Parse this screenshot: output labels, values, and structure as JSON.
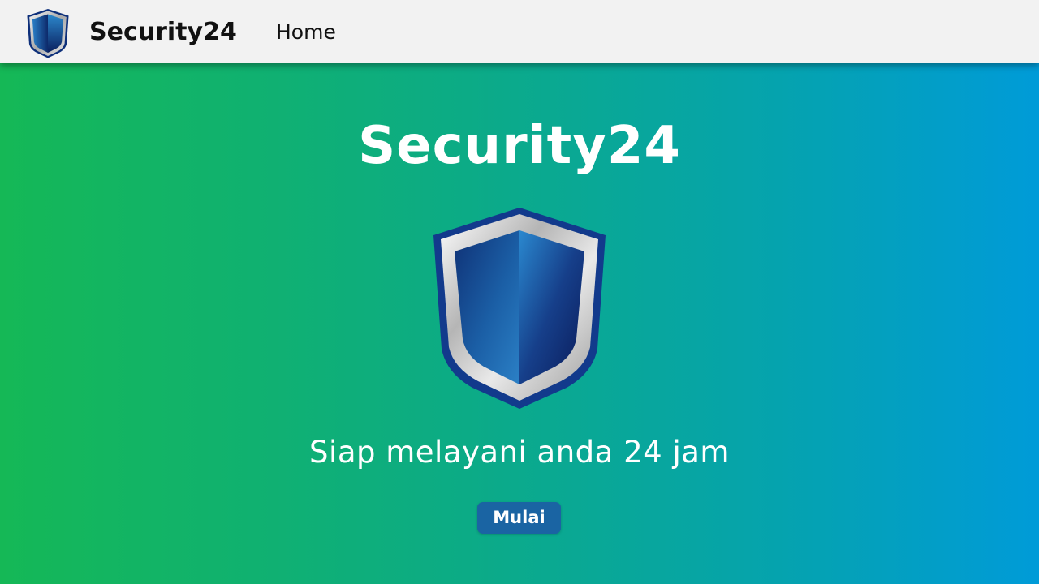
{
  "navbar": {
    "logo_icon": "shield-icon",
    "brand": "Security24",
    "home_label": "Home"
  },
  "hero": {
    "title": "Security24",
    "emblem_icon": "shield-icon",
    "tagline": "Siap melayani anda 24 jam",
    "start_button_label": "Mulai"
  },
  "colors": {
    "navbar_bg": "#f2f2f2",
    "gradient_start": "#15b856",
    "gradient_end": "#009bd8",
    "button_bg": "#1a64a3",
    "shield_dark": "#0d2a6b",
    "shield_light": "#2a7fc7",
    "shield_rim": "#c8c8c8"
  }
}
